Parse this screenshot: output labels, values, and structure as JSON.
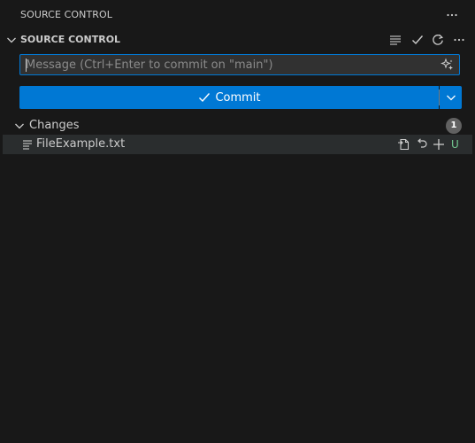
{
  "panel": {
    "title": "SOURCE CONTROL"
  },
  "section": {
    "title": "SOURCE CONTROL"
  },
  "commit": {
    "placeholder": "Message (Ctrl+Enter to commit on \"main\")",
    "value": "",
    "button_label": "Commit"
  },
  "changes": {
    "label": "Changes",
    "count": "1",
    "files": [
      {
        "name": "FileExample.txt",
        "status": "U"
      }
    ]
  },
  "colors": {
    "accent": "#0078d4",
    "untracked": "#73c991",
    "background": "#181818",
    "row_hover": "#2a2d2e"
  },
  "icons": {
    "panel_more": "ellipsis-icon",
    "view_as_tree": "list-flat-icon",
    "commit_check": "check-icon",
    "refresh": "refresh-icon",
    "section_more": "ellipsis-icon",
    "generate_message": "sparkle-icon",
    "commit_dropdown": "chevron-down-icon",
    "open_file": "go-to-file-icon",
    "discard": "discard-icon",
    "stage": "plus-icon"
  }
}
